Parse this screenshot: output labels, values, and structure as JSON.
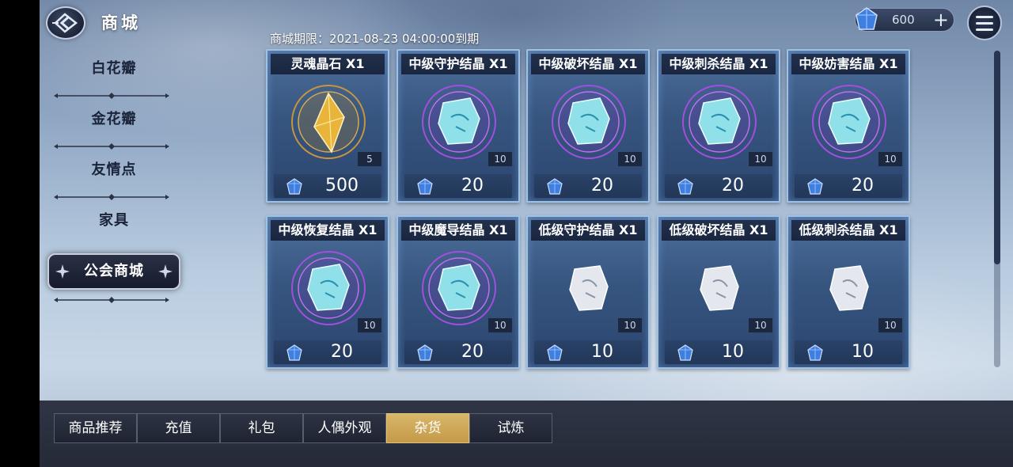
{
  "header": {
    "title": "商城",
    "back_icon": "back-arrow-icon",
    "currency": {
      "icon": "blue-crystal-icon",
      "value": "600",
      "add_label": "+"
    },
    "menu_icon": "hamburger-menu-icon"
  },
  "shop_period": "商城期限：2021-08-23 04:00:00到期",
  "sidebar": {
    "items": [
      {
        "label": "白花瓣"
      },
      {
        "label": "金花瓣"
      },
      {
        "label": "友情点"
      },
      {
        "label": "家具"
      },
      {
        "label": "公会商城"
      }
    ],
    "active_index": 4
  },
  "products": [
    {
      "name": "灵魂晶石 X1",
      "quantity": "5",
      "price": "500",
      "art": "gold-crystal"
    },
    {
      "name": "中级守护结晶 X1",
      "quantity": "10",
      "price": "20",
      "art": "cyan-crystal"
    },
    {
      "name": "中级破坏结晶 X1",
      "quantity": "10",
      "price": "20",
      "art": "cyan-crystal"
    },
    {
      "name": "中级刺杀结晶 X1",
      "quantity": "10",
      "price": "20",
      "art": "cyan-crystal"
    },
    {
      "name": "中级妨害结晶 X1",
      "quantity": "10",
      "price": "20",
      "art": "cyan-crystal"
    },
    {
      "name": "中级恢复结晶 X1",
      "quantity": "10",
      "price": "20",
      "art": "cyan-crystal"
    },
    {
      "name": "中级魔导结晶 X1",
      "quantity": "10",
      "price": "20",
      "art": "cyan-crystal"
    },
    {
      "name": "低级守护结晶 X1",
      "quantity": "10",
      "price": "10",
      "art": "white-crystal"
    },
    {
      "name": "低级破坏结晶 X1",
      "quantity": "10",
      "price": "10",
      "art": "white-crystal"
    },
    {
      "name": "低级刺杀结晶 X1",
      "quantity": "10",
      "price": "10",
      "art": "white-crystal"
    }
  ],
  "price_icon": "blue-crystal-icon",
  "tabs": [
    {
      "label": "商品推荐"
    },
    {
      "label": "充值"
    },
    {
      "label": "礼包"
    },
    {
      "label": "人偶外观"
    },
    {
      "label": "杂货"
    },
    {
      "label": "试炼"
    }
  ],
  "active_tab": 4,
  "colors": {
    "active_tab": "#c9a052",
    "card_border": "#9fc1e3",
    "crystal_blue": "#3f7fe0"
  }
}
